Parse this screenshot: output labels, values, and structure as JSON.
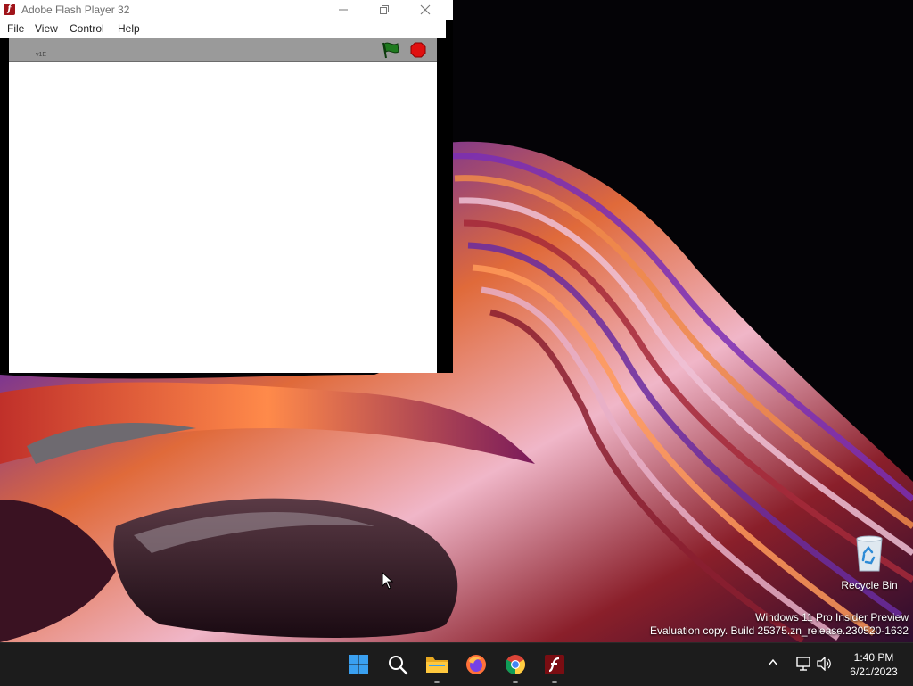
{
  "window": {
    "title": "Adobe Flash Player 32",
    "app_icon": "flash-icon",
    "controls": [
      "minimize-icon",
      "maximize-icon",
      "close-icon"
    ]
  },
  "menu": {
    "items": [
      "File",
      "View",
      "Control",
      "Help"
    ]
  },
  "stage": {
    "version_text": "v1E",
    "green_flag_icon": "green-flag-icon",
    "stop_icon": "stop-icon",
    "colors": {
      "bar": "#9a9a9a",
      "flag": "#1f7a1f",
      "stop": "#e01010"
    }
  },
  "desktop": {
    "recycle_bin_label": "Recycle Bin",
    "watermark_line1": "Windows 11 Pro Insider Preview",
    "watermark_line2": "Evaluation copy. Build 25375.zn_release.230520-1632"
  },
  "taskbar": {
    "apps": [
      {
        "name": "Start",
        "icon": "windows-start-icon"
      },
      {
        "name": "Search",
        "icon": "search-icon"
      },
      {
        "name": "File Explorer",
        "icon": "folder-icon",
        "running": true
      },
      {
        "name": "Firefox",
        "icon": "firefox-icon"
      },
      {
        "name": "Chrome",
        "icon": "chrome-icon",
        "running": true
      },
      {
        "name": "Flash Player",
        "icon": "flash-icon",
        "running": true
      }
    ],
    "time": "1:40 PM",
    "date": "6/21/2023"
  }
}
